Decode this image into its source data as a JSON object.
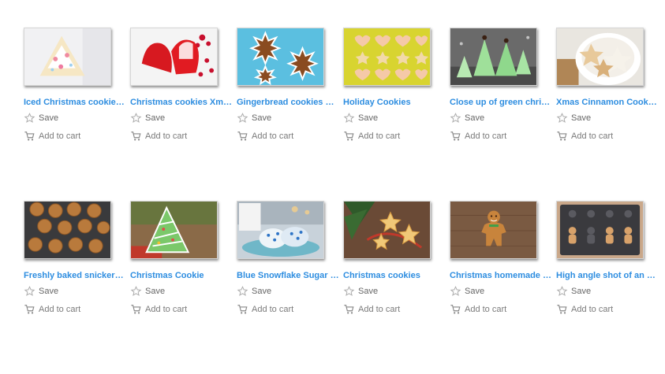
{
  "actions": {
    "save_label": "Save",
    "cart_label": "Add to cart"
  },
  "results": [
    {
      "title": "Iced Christmas cookies on white",
      "thumb": "iced-tree"
    },
    {
      "title": "Christmas cookies Xmas",
      "thumb": "red-bells"
    },
    {
      "title": "Gingerbread cookies with snowflakes",
      "thumb": "snowflakes"
    },
    {
      "title": "Holiday Cookies",
      "thumb": "hearts-stars"
    },
    {
      "title": "Close up of green christmas trees",
      "thumb": "meringue-trees"
    },
    {
      "title": "Xmas Cinnamon Cookies",
      "thumb": "cinnamon-stars"
    },
    {
      "title": "Freshly baked snickerdoodles",
      "thumb": "snickerdoodles"
    },
    {
      "title": "Christmas Cookie",
      "thumb": "tree-cookie"
    },
    {
      "title": "Blue Snowflake Sugar Cookies",
      "thumb": "blue-sugar"
    },
    {
      "title": "Christmas cookies",
      "thumb": "star-cookies"
    },
    {
      "title": "Christmas homemade gingerbread",
      "thumb": "gingerbread-man"
    },
    {
      "title": "High angle shot of an empty tray",
      "thumb": "gingerbread-tray"
    }
  ]
}
